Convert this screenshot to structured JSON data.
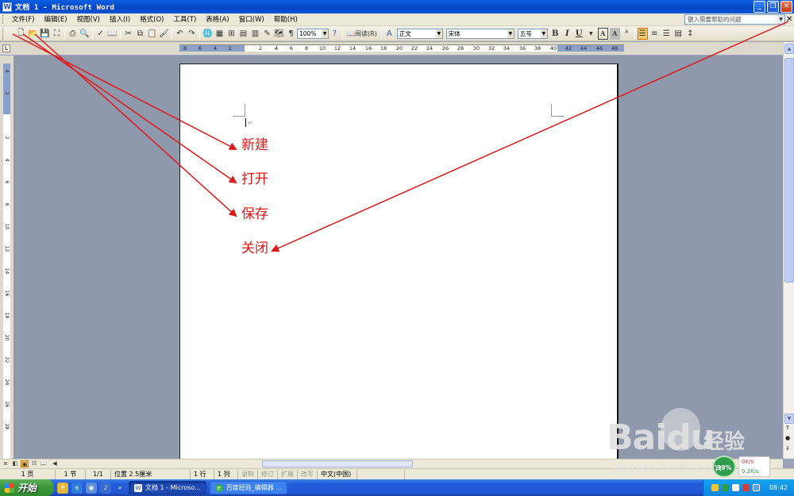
{
  "window": {
    "title": "文档 1 - Microsoft Word",
    "app_icon": "W"
  },
  "menu": {
    "items": [
      "文件(F)",
      "编辑(E)",
      "视图(V)",
      "插入(I)",
      "格式(O)",
      "工具(T)",
      "表格(A)",
      "窗口(W)",
      "帮助(H)"
    ],
    "help_placeholder": "键入需要帮助的问题"
  },
  "toolbar": {
    "zoom": "100%",
    "read_label": "阅读(R)",
    "style": "正文",
    "font": "宋体",
    "size": "五号",
    "bold": "B",
    "italic": "I",
    "underline": "U",
    "char_border": "A",
    "char_shade": "A"
  },
  "ruler": {
    "h_numbers": [
      "8",
      "6",
      "4",
      "2",
      "2",
      "4",
      "6",
      "8",
      "10",
      "12",
      "14",
      "16",
      "18",
      "20",
      "22",
      "24",
      "26",
      "28",
      "30",
      "32",
      "34",
      "36",
      "38",
      "40",
      "42",
      "44",
      "46",
      "48"
    ],
    "v_numbers": [
      "4",
      "2",
      "2",
      "4",
      "6",
      "8",
      "10",
      "12",
      "14",
      "16",
      "18",
      "20",
      "22",
      "24",
      "26",
      "28"
    ]
  },
  "document": {
    "annotations": [
      {
        "label": "新建",
        "target": "new"
      },
      {
        "label": "打开",
        "target": "open"
      },
      {
        "label": "保存",
        "target": "save"
      },
      {
        "label": "关闭",
        "target": "close"
      }
    ]
  },
  "statusbar": {
    "page": "1 页",
    "section": "1 节",
    "page_of": "1/1",
    "position": "位置 2.5厘米",
    "line": "1 行",
    "column": "1 列",
    "rec": "录制",
    "trk": "修订",
    "ext": "扩展",
    "ovr": "改写",
    "lang": "中文(中国)"
  },
  "taskbar": {
    "start_label": "开始",
    "tasks": [
      {
        "label": "文档 1 - Microso...",
        "active": true
      },
      {
        "label": "百度经验_编辑器 ...",
        "active": false
      }
    ],
    "clock": "08:42"
  },
  "overlay": {
    "gauge": "39%",
    "net_up": "0K/s",
    "net_down": "0.2K/s",
    "watermark_brand": "Baidu",
    "watermark_cn": "经验",
    "watermark_url": "jingyan.baidu.com"
  },
  "colors": {
    "annotation": "#e01818",
    "titlebar": "#0a54d6"
  }
}
